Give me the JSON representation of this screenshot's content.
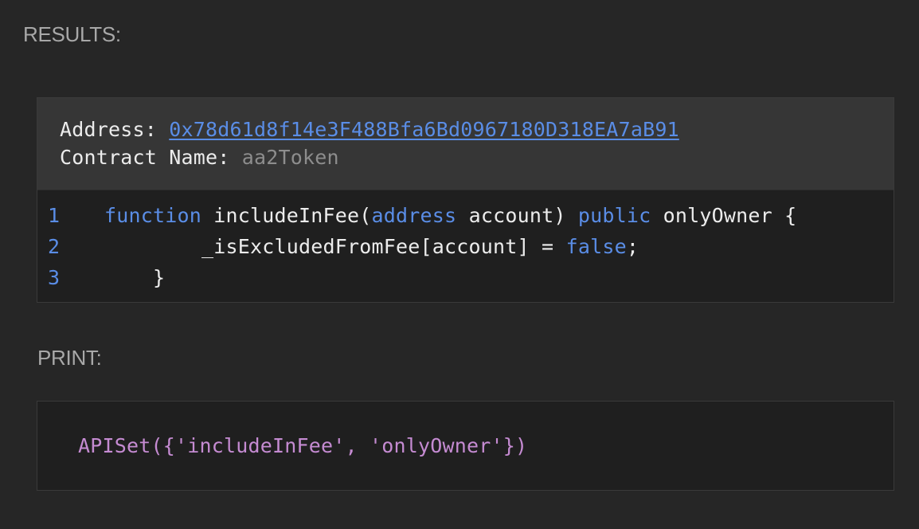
{
  "results": {
    "label": "RESULTS:",
    "address_label": "Address: ",
    "address_value": "0x78d61d8f14e3F488Bfa6Bd0967180D318EA7aB91",
    "contract_name_label": "Contract Name: ",
    "contract_name_value": "aa2Token"
  },
  "code": {
    "lines": [
      {
        "number": "1",
        "tokens": [
          "function",
          " includeInFee(",
          "address",
          " account) ",
          "public",
          " onlyOwner {"
        ]
      },
      {
        "number": "2",
        "tokens": [
          "        _isExcludedFromFee[account] = ",
          "false",
          ";"
        ]
      },
      {
        "number": "3",
        "tokens": [
          "    }"
        ]
      }
    ]
  },
  "print": {
    "label": "PRINT:",
    "output": "APISet({'includeInFee', 'onlyOwner'})"
  },
  "colors": {
    "background": "#262626",
    "header_background": "#363636",
    "code_background": "#1f1f1f",
    "keyword": "#5a8de6",
    "link": "#5a8de6",
    "print_text": "#c58bd2",
    "muted_text": "#8d8d8d"
  }
}
